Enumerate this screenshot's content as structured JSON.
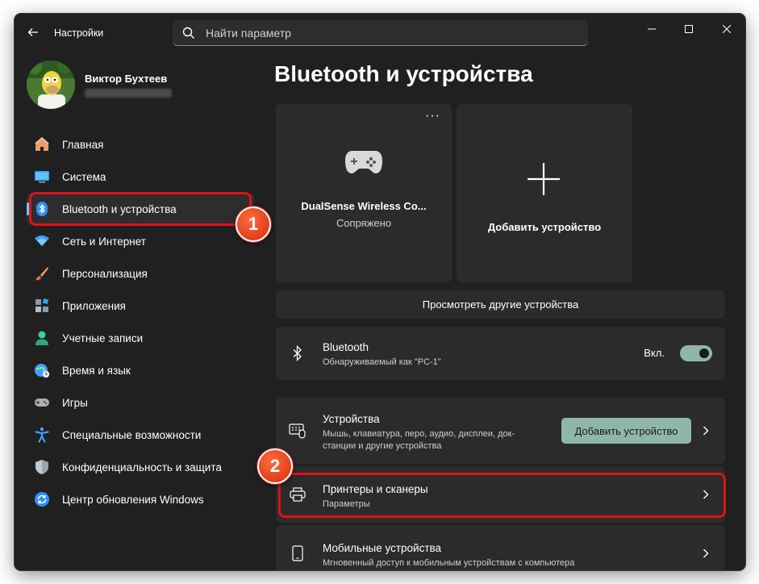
{
  "window": {
    "title": "Настройки"
  },
  "search": {
    "placeholder": "Найти параметр"
  },
  "user": {
    "name": "Виктор Бухтеев"
  },
  "sidebar": {
    "items": [
      {
        "label": "Главная",
        "icon": "home-icon",
        "color": "#f0a070"
      },
      {
        "label": "Система",
        "icon": "monitor-icon",
        "color": "#4fb3ff"
      },
      {
        "label": "Bluetooth и устройства",
        "icon": "bluetooth-icon",
        "color": "#2f8fff",
        "active": true
      },
      {
        "label": "Сеть и Интернет",
        "icon": "wifi-icon",
        "color": "#6fc2ff"
      },
      {
        "label": "Персонализация",
        "icon": "brush-icon",
        "color": "#e59a5a"
      },
      {
        "label": "Приложения",
        "icon": "apps-icon",
        "color": "#9aa6b8"
      },
      {
        "label": "Учетные записи",
        "icon": "person-icon",
        "color": "#3ecf9a"
      },
      {
        "label": "Время и язык",
        "icon": "globe-clock-icon",
        "color": "#3fa4ff"
      },
      {
        "label": "Игры",
        "icon": "gamepad-icon",
        "color": "#b0b0b0"
      },
      {
        "label": "Специальные возможности",
        "icon": "accessibility-icon",
        "color": "#4fb3ff"
      },
      {
        "label": "Конфиденциальность и защита",
        "icon": "shield-icon",
        "color": "#a0a8b4"
      },
      {
        "label": "Центр обновления Windows",
        "icon": "update-icon",
        "color": "#2f8fff"
      }
    ]
  },
  "main": {
    "title": "Bluetooth и устройства",
    "device_card": {
      "name": "DualSense Wireless Co...",
      "status": "Сопряжено",
      "more": "···"
    },
    "add_card": {
      "label": "Добавить устройство"
    },
    "view_more": "Просмотреть другие устройства",
    "bluetooth": {
      "title": "Bluetooth",
      "subtitle": "Обнаруживаемый как \"PC-1\"",
      "toggle_label": "Вкл.",
      "on": true
    },
    "devices": {
      "title": "Устройства",
      "subtitle_line1": "Мышь, клавиатура, перо, аудио, дисплеи, док-",
      "subtitle_line2": "станции и другие устройства",
      "button": "Добавить устройство"
    },
    "printers": {
      "title": "Принтеры и сканеры",
      "subtitle": "Параметры"
    },
    "mobile": {
      "title": "Мобильные устройства",
      "subtitle": "Мгновенный доступ к мобильным устройствам с компьютера"
    }
  },
  "annotations": {
    "badge1": "1",
    "badge2": "2"
  },
  "colors": {
    "accent": "#60cdff",
    "toggle": "#8fb7a8",
    "highlight": "#e0101b",
    "background": "#202020",
    "card": "#2b2b2b"
  }
}
